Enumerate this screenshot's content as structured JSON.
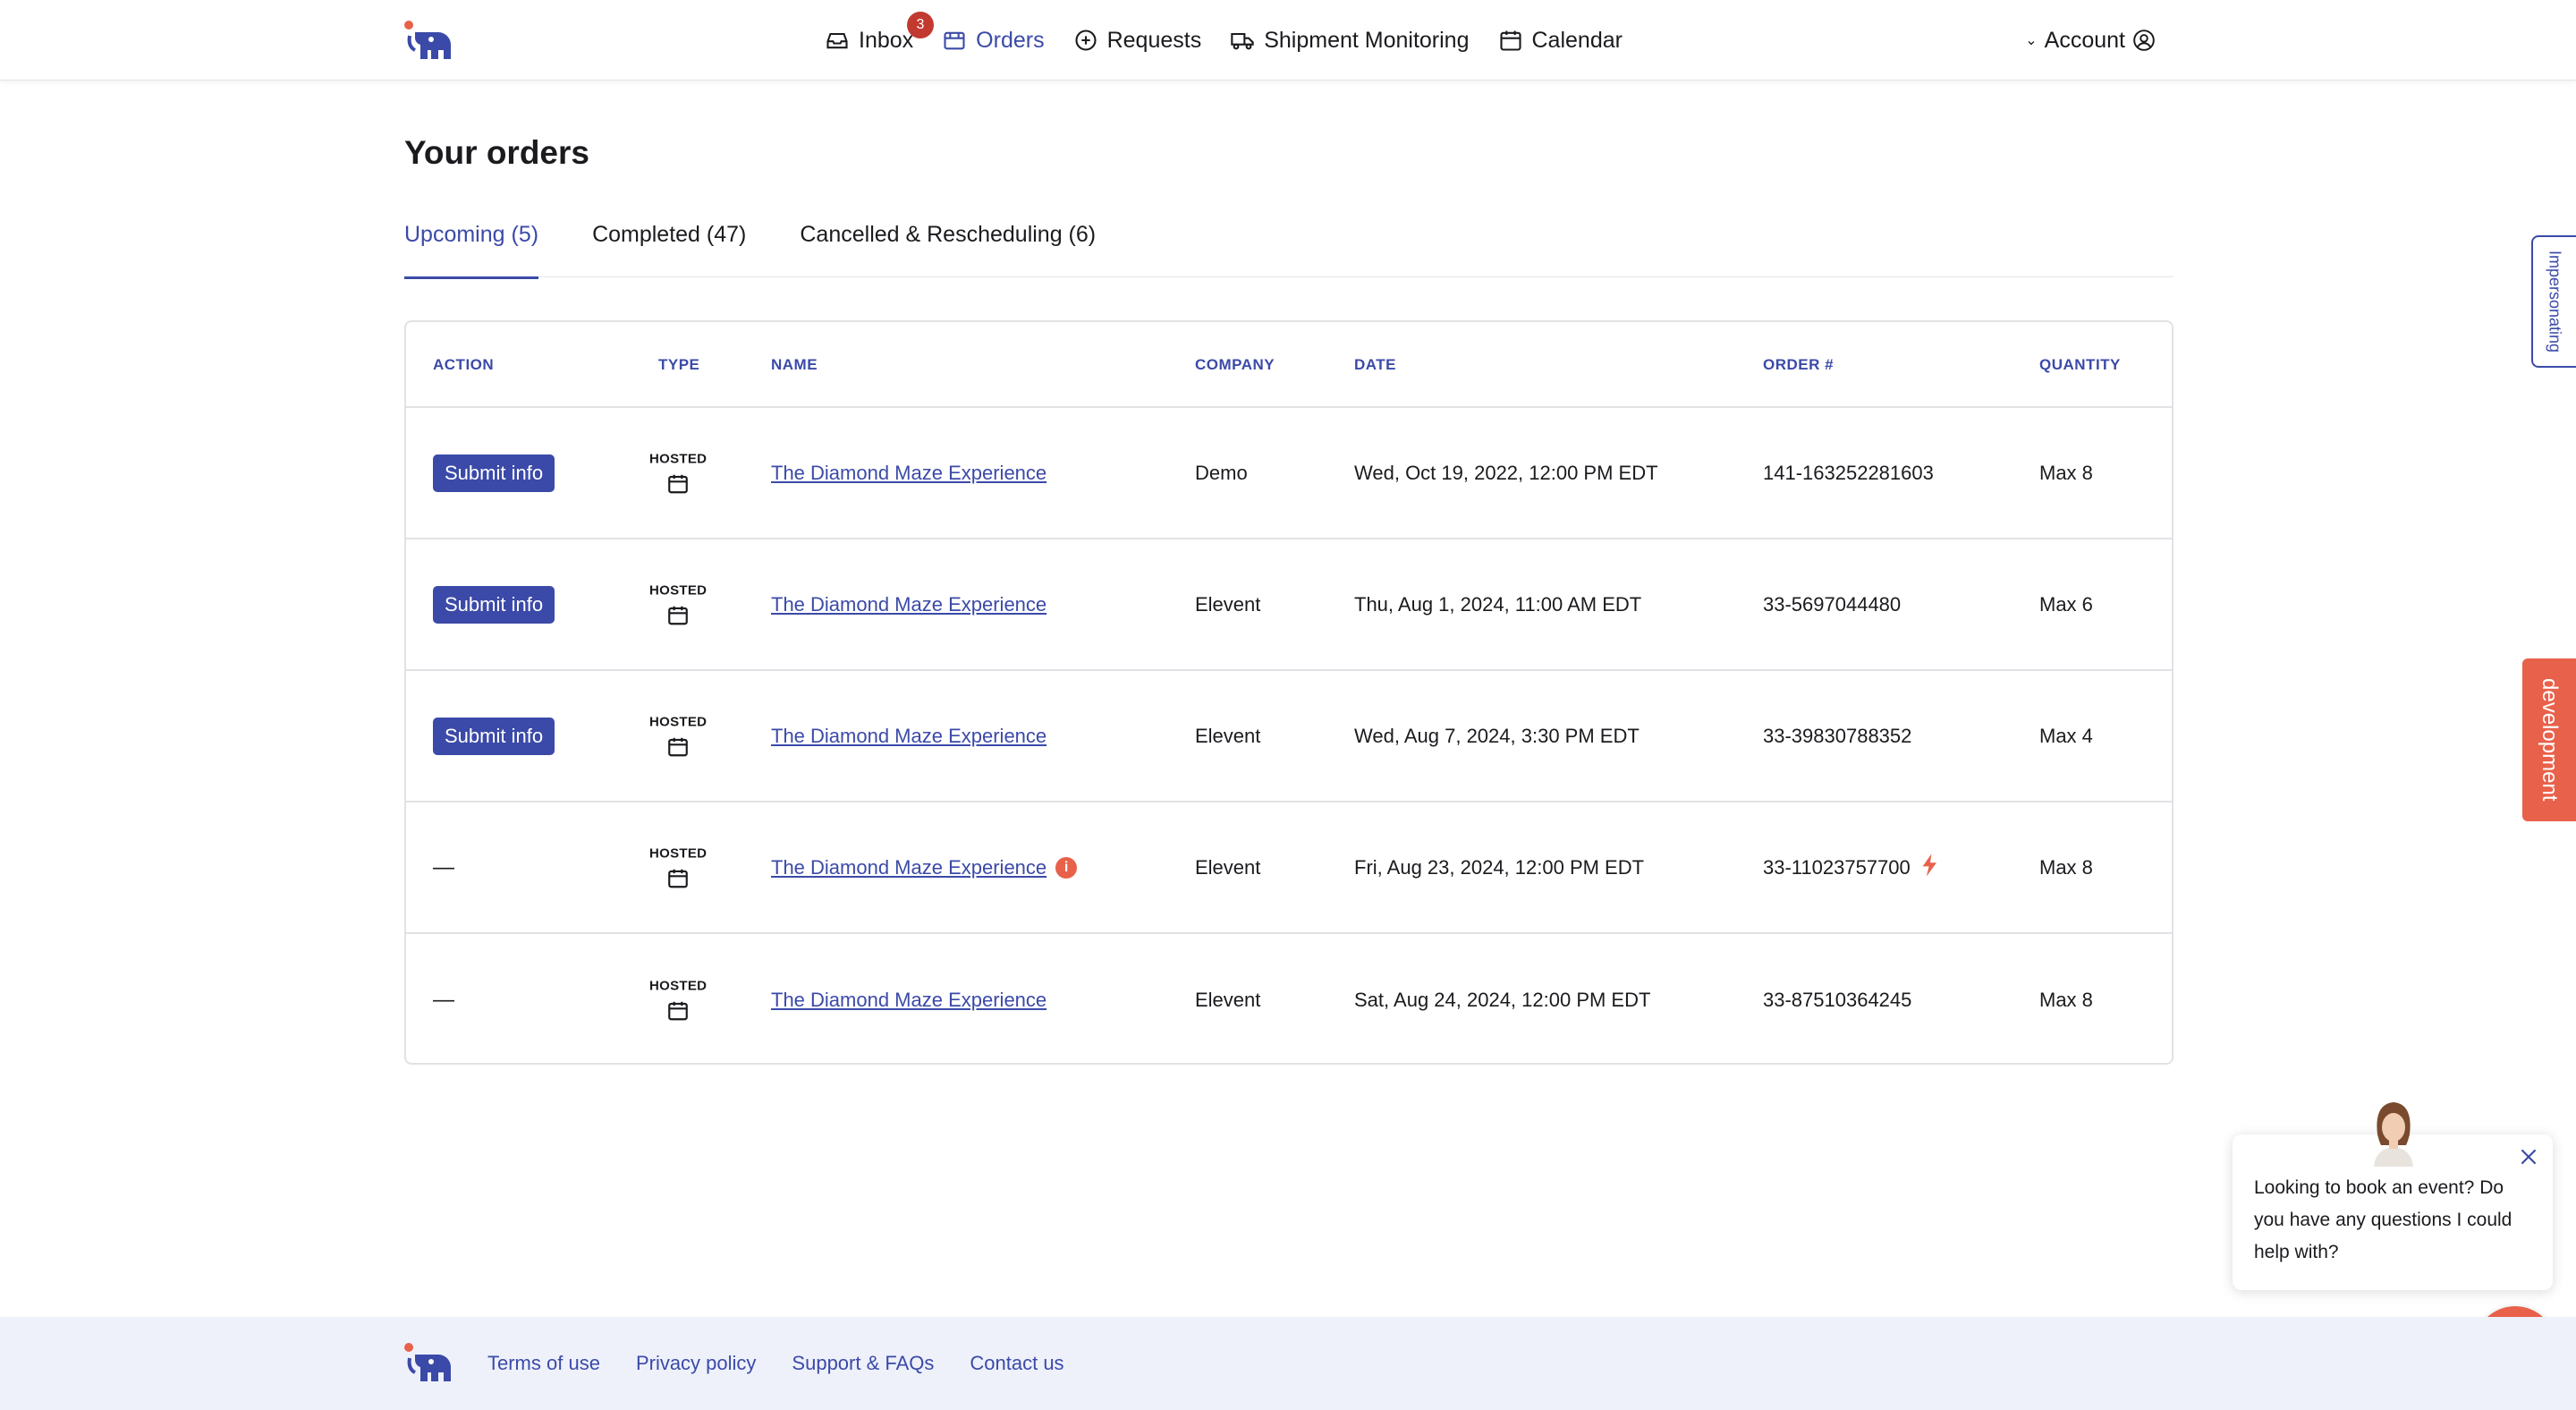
{
  "nav": {
    "items": [
      {
        "label": "Inbox",
        "icon": "inbox-icon",
        "badge": "3",
        "active": false
      },
      {
        "label": "Orders",
        "icon": "box-icon",
        "active": true
      },
      {
        "label": "Requests",
        "icon": "plus-circle-icon",
        "active": false
      },
      {
        "label": "Shipment Monitoring",
        "icon": "truck-icon",
        "active": false
      },
      {
        "label": "Calendar",
        "icon": "calendar-icon",
        "active": false
      }
    ],
    "account_label": "Account"
  },
  "page": {
    "title": "Your orders"
  },
  "tabs": [
    {
      "label": "Upcoming (5)",
      "active": true
    },
    {
      "label": "Completed (47)",
      "active": false
    },
    {
      "label": "Cancelled & Rescheduling (6)",
      "active": false
    }
  ],
  "table": {
    "headers": {
      "action": "ACTION",
      "type": "TYPE",
      "name": "NAME",
      "company": "COMPANY",
      "date": "DATE",
      "order": "ORDER #",
      "quantity": "QUANTITY"
    },
    "rows": [
      {
        "action": "Submit info",
        "type": "HOSTED",
        "name": "The Diamond Maze Experience",
        "info": false,
        "company": "Demo",
        "date": "Wed, Oct 19, 2022, 12:00 PM EDT",
        "order": "141-163252281603",
        "flash": false,
        "quantity": "Max 8"
      },
      {
        "action": "Submit info",
        "type": "HOSTED",
        "name": "The Diamond Maze Experience",
        "info": false,
        "company": "Elevent",
        "date": "Thu, Aug 1, 2024, 11:00 AM EDT",
        "order": "33-5697044480",
        "flash": false,
        "quantity": "Max 6"
      },
      {
        "action": "Submit info",
        "type": "HOSTED",
        "name": "The Diamond Maze Experience",
        "info": false,
        "company": "Elevent",
        "date": "Wed, Aug 7, 2024, 3:30 PM EDT",
        "order": "33-39830788352",
        "flash": false,
        "quantity": "Max 4"
      },
      {
        "action": "—",
        "type": "HOSTED",
        "name": "The Diamond Maze Experience",
        "info": true,
        "company": "Elevent",
        "date": "Fri, Aug 23, 2024, 12:00 PM EDT",
        "order": "33-11023757700",
        "flash": true,
        "quantity": "Max 8"
      },
      {
        "action": "—",
        "type": "HOSTED",
        "name": "The Diamond Maze Experience",
        "info": false,
        "company": "Elevent",
        "date": "Sat, Aug 24, 2024, 12:00 PM EDT",
        "order": "33-87510364245",
        "flash": false,
        "quantity": "Max 8"
      }
    ]
  },
  "side_tabs": {
    "impersonating": "Impersonating",
    "development": "development"
  },
  "chat": {
    "message": "Looking to book an event? Do you have any questions I could help with?"
  },
  "footer": {
    "links": [
      "Terms of use",
      "Privacy policy",
      "Support & FAQs",
      "Contact us"
    ]
  },
  "colors": {
    "primary": "#3b4aa8",
    "accent": "#e8614a",
    "badge": "#c23a2f",
    "footer_bg": "#eef1fa"
  }
}
